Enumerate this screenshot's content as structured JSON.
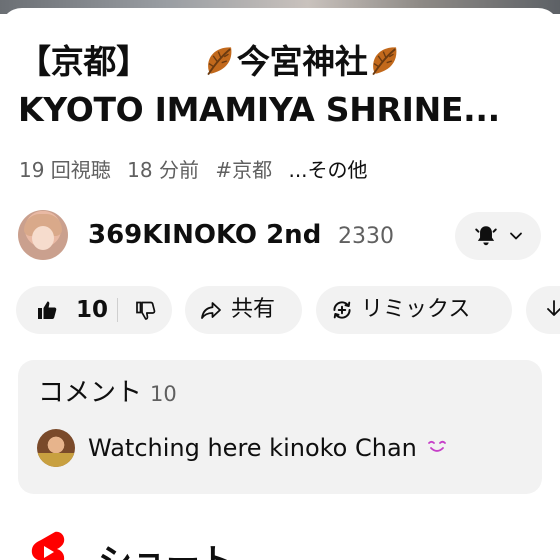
{
  "video": {
    "title_line1_bracket": "【京都】",
    "title_line1_name": "今宮神社",
    "title_line2": "KYOTO IMAMIYA SHRINE...",
    "views": "19 回視聴",
    "time_ago": "18 分前",
    "hashtag": "#京都",
    "more": "...その他"
  },
  "channel": {
    "name": "369KINOKO 2nd",
    "subscribers": "2330"
  },
  "actions": {
    "like_count": "10",
    "share_label": "共有",
    "remix_label": "リミックス"
  },
  "comments": {
    "heading": "コメント",
    "count": "10",
    "top_comment": "Watching here kinoko Chan"
  },
  "shorts": {
    "heading": "ショート"
  },
  "icons": {
    "title_emoji": "fallen-leaf-icon",
    "notification": "bell-icon",
    "like": "thumbs-up-icon",
    "dislike": "thumbs-down-icon",
    "share": "share-arrow-icon",
    "remix": "remix-icon",
    "download": "download-icon",
    "shorts": "shorts-logo-icon"
  },
  "colors": {
    "pill_background": "#f2f2f2",
    "secondary_text": "#606060",
    "leaf": "#c2691c",
    "shorts_red": "#ff0000"
  }
}
